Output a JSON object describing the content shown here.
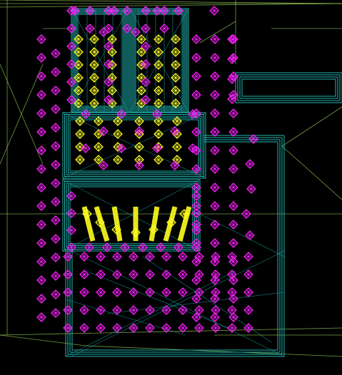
{
  "viewport": {
    "label": "",
    "background": "#000000",
    "colors": {
      "guide_line": "#9bd35a",
      "mesh_wire": "#20b7b3",
      "light_probe": "#ff20ff",
      "selected_probe": "#ffff20"
    }
  }
}
